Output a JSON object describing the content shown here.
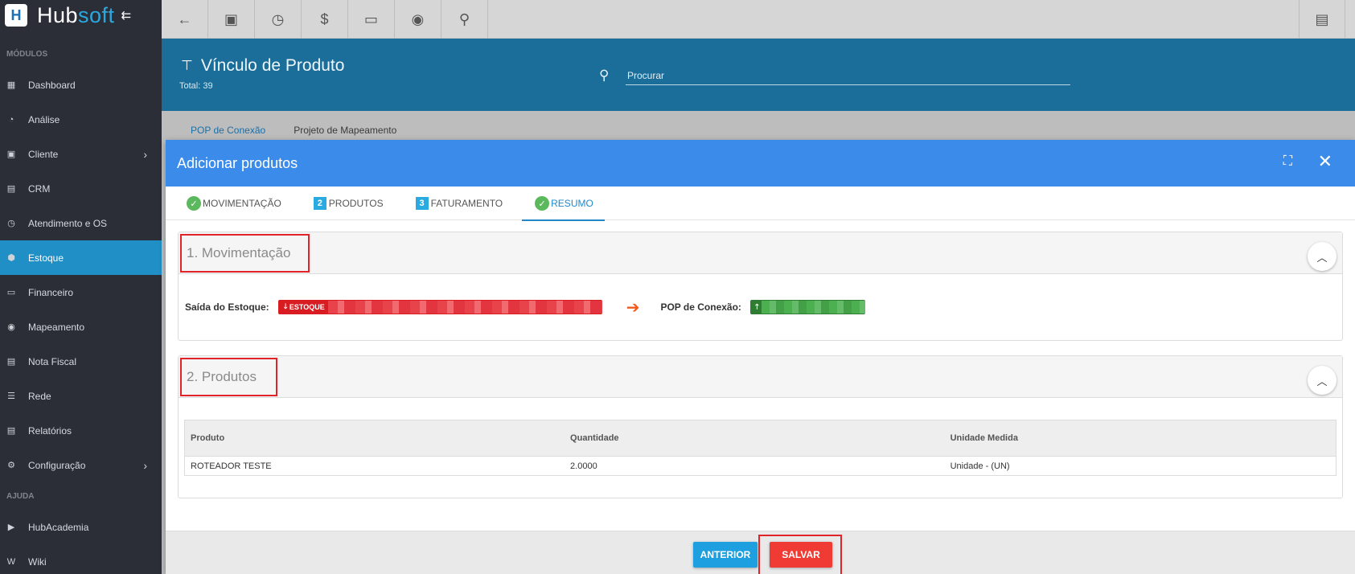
{
  "brand": {
    "name_main": "Hub",
    "name_accent": "soft"
  },
  "sidebar": {
    "section_modules": "MÓDULOS",
    "section_help": "AJUDA",
    "items": [
      {
        "label": "Dashboard",
        "icon": "dashboard-icon",
        "glyph": "▦"
      },
      {
        "label": "Análise",
        "icon": "pie-chart-icon",
        "glyph": "◔"
      },
      {
        "label": "Cliente",
        "icon": "contact-icon",
        "glyph": "▣"
      },
      {
        "label": "CRM",
        "icon": "crm-icon",
        "glyph": "▤"
      },
      {
        "label": "Atendimento e OS",
        "icon": "calendar-clock-icon",
        "glyph": "◷"
      },
      {
        "label": "Estoque",
        "icon": "cube-icon",
        "glyph": "⬢"
      },
      {
        "label": "Financeiro",
        "icon": "money-icon",
        "glyph": "▭"
      },
      {
        "label": "Mapeamento",
        "icon": "map-pin-icon",
        "glyph": "◉"
      },
      {
        "label": "Nota Fiscal",
        "icon": "invoice-icon",
        "glyph": "▤"
      },
      {
        "label": "Rede",
        "icon": "network-icon",
        "glyph": "☰"
      },
      {
        "label": "Relatórios",
        "icon": "report-icon",
        "glyph": "▤"
      },
      {
        "label": "Configuração",
        "icon": "gear-icon",
        "glyph": "⚙"
      }
    ],
    "help_items": [
      {
        "label": "HubAcademia",
        "icon": "youtube-icon",
        "glyph": "▶"
      },
      {
        "label": "Wiki",
        "icon": "wikipedia-icon",
        "glyph": "W"
      }
    ]
  },
  "header": {
    "title": "Vínculo de Produto",
    "total": "Total: 39",
    "search_placeholder": "Procurar"
  },
  "page_tabs": [
    "POP de Conexão",
    "Projeto de Mapeamento"
  ],
  "modal": {
    "title": "Adicionar produtos",
    "steps": [
      {
        "label": "MOVIMENTAÇÃO",
        "badge": "✓"
      },
      {
        "label": "PRODUTOS",
        "badge": "2"
      },
      {
        "label": "FATURAMENTO",
        "badge": "3"
      },
      {
        "label": "RESUMO",
        "badge": "✓"
      }
    ],
    "mov_panel": {
      "title": "1. Movimentação",
      "source_label": "Saída do Estoque:",
      "source_tag": "ESTOQUE",
      "dest_label": "POP de Conexão:"
    },
    "prod_panel": {
      "title": "2. Produtos",
      "columns": [
        "Produto",
        "Quantidade",
        "Unidade Medida"
      ],
      "rows": [
        [
          "ROTEADOR TESTE",
          "2.0000",
          "Unidade - (UN)"
        ]
      ]
    },
    "buttons": {
      "prev": "ANTERIOR",
      "save": "SALVAR"
    }
  },
  "colors": {
    "accent": "#1f8fc6",
    "modal_header": "#3b8beb",
    "save": "#ef3b33",
    "prev": "#1e9fe0"
  }
}
